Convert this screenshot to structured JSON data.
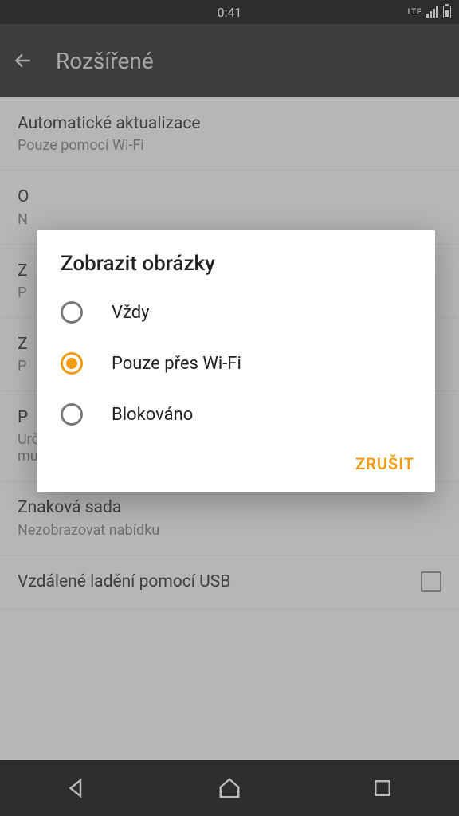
{
  "status": {
    "time": "0:41",
    "lte": "LTE"
  },
  "appbar": {
    "title": "Rozšířené"
  },
  "settings": [
    {
      "title": "Automatické aktualizace",
      "sub": "Pouze pomocí Wi-Fi"
    },
    {
      "title": "O",
      "sub": "N"
    },
    {
      "title": "Z",
      "sub": "P"
    },
    {
      "title": "Z",
      "sub": "P"
    },
    {
      "title": "P",
      "sub": "Určuje, zda weby smí automaticky přehrávat videa či jiný multimediální obsah"
    },
    {
      "title": "Znaková sada",
      "sub": "Nezobrazovat nabídku"
    },
    {
      "title": "Vzdálené ladění pomocí USB",
      "sub": ""
    }
  ],
  "dialog": {
    "title": "Zobrazit obrázky",
    "options": [
      {
        "label": "Vždy",
        "checked": false
      },
      {
        "label": "Pouze přes Wi-Fi",
        "checked": true
      },
      {
        "label": "Blokováno",
        "checked": false
      }
    ],
    "cancel": "ZRUŠIT"
  },
  "colors": {
    "accent": "#f39c12"
  }
}
